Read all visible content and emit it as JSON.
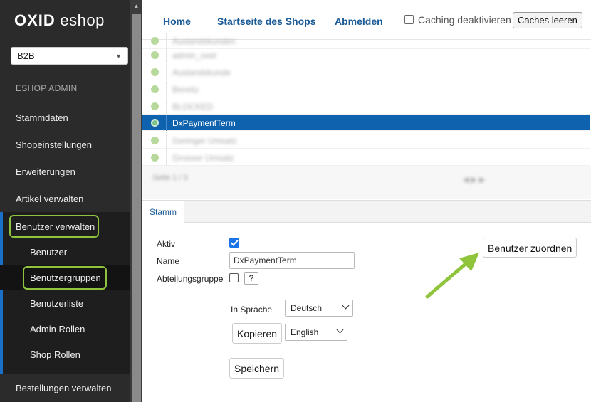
{
  "app": {
    "logo_bold": "OXID",
    "logo_light": "eshop",
    "shop_select": "B2B",
    "admin_label": "ESHOP ADMIN"
  },
  "sidebar": {
    "items": [
      {
        "label": "Stammdaten"
      },
      {
        "label": "Shopeinstellungen"
      },
      {
        "label": "Erweiterungen"
      },
      {
        "label": "Artikel verwalten"
      },
      {
        "label": "Benutzer verwalten"
      },
      {
        "label": "Bestellungen verwalten"
      }
    ],
    "subitems": [
      {
        "label": "Benutzer"
      },
      {
        "label": "Benutzergruppen"
      },
      {
        "label": "Benutzerliste"
      },
      {
        "label": "Admin Rollen"
      },
      {
        "label": "Shop Rollen"
      }
    ]
  },
  "topbar": {
    "home": "Home",
    "startseite": "Startseite des Shops",
    "abmelden": "Abmelden",
    "caching_label": "Caching deaktivieren",
    "caches_button": "Caches leeren"
  },
  "list": {
    "rows": [
      {
        "label": "Auslandskunden",
        "selected": false
      },
      {
        "label": "admin_oxid",
        "selected": false
      },
      {
        "label": "Auslandskunde",
        "selected": false
      },
      {
        "label": "Bereitz",
        "selected": false
      },
      {
        "label": "BLOCKED",
        "selected": false
      },
      {
        "label": "DxPaymentTerm",
        "selected": true
      },
      {
        "label": "Geringer Umsatz",
        "selected": false
      },
      {
        "label": "Grosser Umsatz",
        "selected": false
      }
    ],
    "pager": "Seite 1 / 3"
  },
  "tabs": [
    {
      "label": "Stamm"
    }
  ],
  "form": {
    "aktiv_label": "Aktiv",
    "aktiv_checked": true,
    "name_label": "Name",
    "name_value": "DxPaymentTerm",
    "abteilung_label": "Abteilungsgruppe",
    "abteilung_checked": false,
    "help_label": "?",
    "sprache_label": "In Sprache",
    "sprache_value": "Deutsch",
    "kopieren_button": "Kopieren",
    "copy_lang_value": "English",
    "speichern_button": "Speichern",
    "zuordnen_button": "Benutzer zuordnen"
  },
  "colors": {
    "accent": "#0f62ad",
    "highlight": "#8fc43c",
    "sidebar_bg": "#2b2b2b"
  }
}
